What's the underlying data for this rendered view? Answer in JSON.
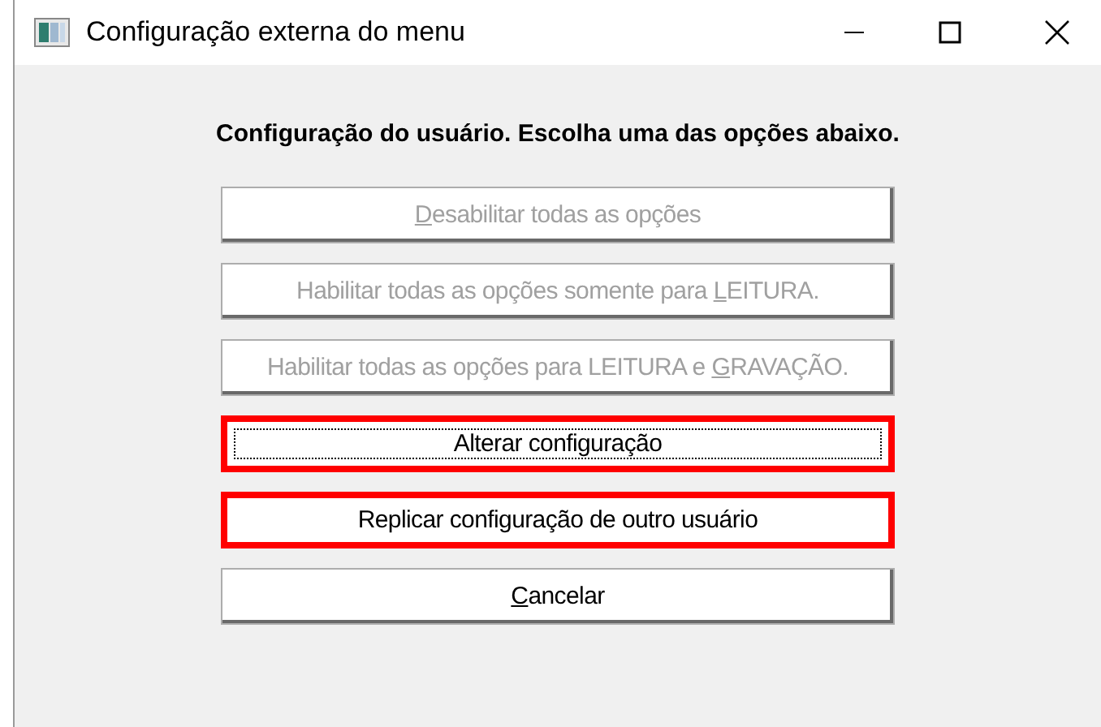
{
  "window": {
    "title": "Configuração externa do menu"
  },
  "heading": "Configuração do usuário. Escolha uma das opções abaixo.",
  "buttons": [
    {
      "access_key": "D",
      "label_end": "esabilitar todas as opções",
      "disabled": true,
      "highlighted": false,
      "focused": false
    },
    {
      "label_start": "Habilitar todas as opções somente para ",
      "access_key": "L",
      "label_end": "EITURA.",
      "disabled": true,
      "highlighted": false,
      "focused": false
    },
    {
      "label_start": "Habilitar todas as opções para LEITURA e ",
      "access_key": "G",
      "label_end": "RAVAÇÃO.",
      "disabled": true,
      "highlighted": false,
      "focused": false
    },
    {
      "label_start": "Alterar configuração",
      "disabled": false,
      "highlighted": true,
      "focused": true
    },
    {
      "label_start": "Replicar configuração de outro usuário",
      "disabled": false,
      "highlighted": true,
      "focused": false
    },
    {
      "access_key": "C",
      "label_end": "ancelar",
      "disabled": false,
      "highlighted": false,
      "focused": false
    }
  ]
}
